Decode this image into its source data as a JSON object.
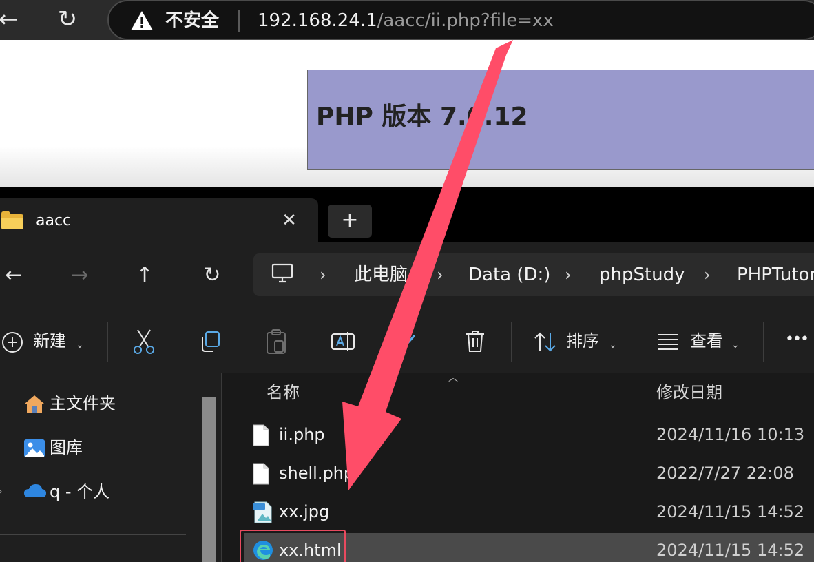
{
  "browser": {
    "security_label": "不安全",
    "url_host": "192.168.24.1",
    "url_path": "/aacc/ii.php?file=xx",
    "back_glyph": "←",
    "reload_glyph": "↻"
  },
  "page": {
    "php_heading": "PHP 版本 7.0.12"
  },
  "explorer": {
    "tab": {
      "label": "aacc",
      "close_glyph": "✕"
    },
    "new_tab_glyph": "+",
    "nav_buttons": {
      "back": "←",
      "forward": "→",
      "up": "↑",
      "refresh": "↻"
    },
    "breadcrumb": [
      "此电脑",
      "Data (D:)",
      "phpStudy",
      "PHPTutor"
    ],
    "breadcrumb_separator": "›",
    "toolbar": {
      "new_label": "新建",
      "sort_label": "排序",
      "view_label": "查看",
      "more_label": "•••"
    },
    "nav_pane": {
      "items": [
        {
          "label": "主文件夹",
          "icon": "home-icon"
        },
        {
          "label": "图库",
          "icon": "gallery-icon"
        },
        {
          "label": "q - 个人",
          "icon": "onedrive-icon"
        }
      ]
    },
    "columns": {
      "name": "名称",
      "modified": "修改日期"
    },
    "files": [
      {
        "name": "ii.php",
        "modified": "2024/11/16 10:13",
        "icon": "file-icon"
      },
      {
        "name": "shell.php",
        "modified": "2022/7/27 22:08",
        "icon": "file-icon"
      },
      {
        "name": "xx.jpg",
        "modified": "2024/11/15 14:52",
        "icon": "jpg-file-icon"
      },
      {
        "name": "xx.html",
        "modified": "2024/11/15 14:52",
        "icon": "edge-html-icon",
        "selected": true
      }
    ]
  },
  "annotation": {
    "arrow_color": "#ff4d68"
  }
}
